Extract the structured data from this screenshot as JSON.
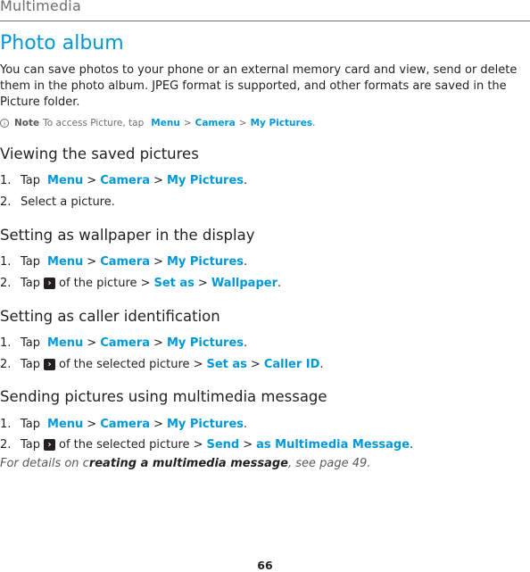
{
  "header": {
    "section": "Multimedia"
  },
  "title": "Photo album",
  "intro": "You can save photos to your phone or an external memory card and view, send or delete them in the photo album. JPEG format is supported, and other formats are saved in the Picture folder.",
  "note": {
    "icon": "info-icon",
    "label": "Note",
    "text": "To access Picture, tap",
    "path": [
      "Menu",
      "Camera",
      "My Pictures"
    ],
    "end": "."
  },
  "sections": [
    {
      "heading": "Viewing the saved pictures",
      "steps": [
        {
          "num": "1.",
          "pre": "Tap",
          "path": [
            "Menu",
            "Camera",
            "My Pictures"
          ],
          "end": "."
        },
        {
          "num": "2.",
          "text": "Select a picture."
        }
      ]
    },
    {
      "heading": "Setting as wallpaper in the display",
      "steps": [
        {
          "num": "1.",
          "pre": "Tap",
          "path": [
            "Menu",
            "Camera",
            "My Pictures"
          ],
          "end": "."
        },
        {
          "num": "2.",
          "pre": "Tap",
          "mid": "of the picture",
          "path": [
            "Set as",
            "Wallpaper"
          ],
          "end": "."
        }
      ]
    },
    {
      "heading": "Setting as caller identification",
      "steps": [
        {
          "num": "1.",
          "pre": "Tap",
          "path": [
            "Menu",
            "Camera",
            "My Pictures"
          ],
          "end": "."
        },
        {
          "num": "2.",
          "pre": "Tap",
          "mid": "of the selected picture",
          "path": [
            "Set as",
            "Caller ID"
          ],
          "end": "."
        }
      ]
    },
    {
      "heading": "Sending pictures using multimedia message",
      "steps": [
        {
          "num": "1.",
          "pre": "Tap",
          "path": [
            "Menu",
            "Camera",
            "My Pictures"
          ],
          "end": "."
        },
        {
          "num": "2.",
          "pre": "Tap",
          "mid": "of the selected picture",
          "path": [
            "Send",
            "as Multimedia Message"
          ],
          "end": "."
        }
      ]
    }
  ],
  "reference": {
    "pre": "For details on c",
    "bold": "reating a multimedia message",
    "post": ", see page 49."
  },
  "separator": ">",
  "arrow_icon": "chevron-right-icon",
  "page_number": "66"
}
